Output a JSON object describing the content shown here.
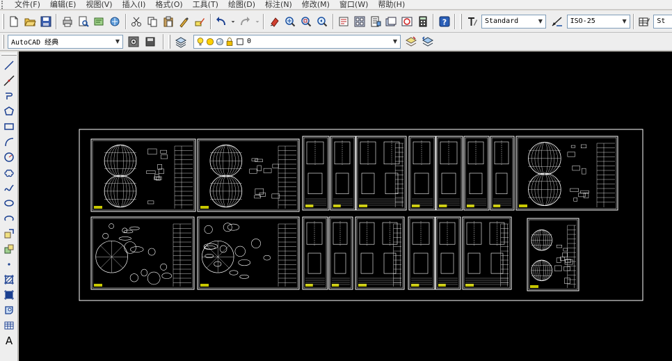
{
  "menubar": {
    "items": [
      {
        "id": "file",
        "label": "文件(F)"
      },
      {
        "id": "edit",
        "label": "编辑(E)"
      },
      {
        "id": "view",
        "label": "视图(V)"
      },
      {
        "id": "insert",
        "label": "插入(I)"
      },
      {
        "id": "format",
        "label": "格式(O)"
      },
      {
        "id": "tools",
        "label": "工具(T)"
      },
      {
        "id": "draw",
        "label": "绘图(D)"
      },
      {
        "id": "dimension",
        "label": "标注(N)"
      },
      {
        "id": "modify",
        "label": "修改(M)"
      },
      {
        "id": "window",
        "label": "窗口(W)"
      },
      {
        "id": "help",
        "label": "帮助(H)"
      }
    ]
  },
  "toolbar1": {
    "text_style": "Standard",
    "dim_style": "ISO-25",
    "table_style": "St"
  },
  "toolbar2": {
    "workspace": "AutoCAD 经典",
    "layer": "0"
  },
  "left_palette": {
    "text_tool_label": "A"
  },
  "colors": {
    "canvas_bg": "#000000",
    "linework": "#ffffff",
    "title_block_accent": "#c8c800",
    "toolbar_bg": "#eeeeee"
  }
}
